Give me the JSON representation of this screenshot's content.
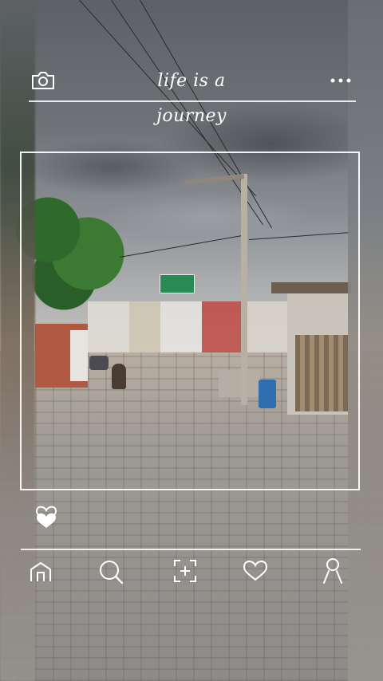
{
  "app": {
    "title": "life is a journey"
  },
  "header": {
    "camera_icon": "camera-icon",
    "more_icon": "more-horizontal-icon"
  },
  "like": {
    "icon": "heart-filled-icon"
  },
  "bottom_nav": {
    "items": [
      {
        "icon": "home-icon"
      },
      {
        "icon": "search-icon"
      },
      {
        "icon": "add-scan-icon"
      },
      {
        "icon": "heart-outline-icon"
      },
      {
        "icon": "profile-icon"
      }
    ]
  },
  "photo": {
    "sign_color": "#2a8a56",
    "accent": "#ffffff"
  }
}
